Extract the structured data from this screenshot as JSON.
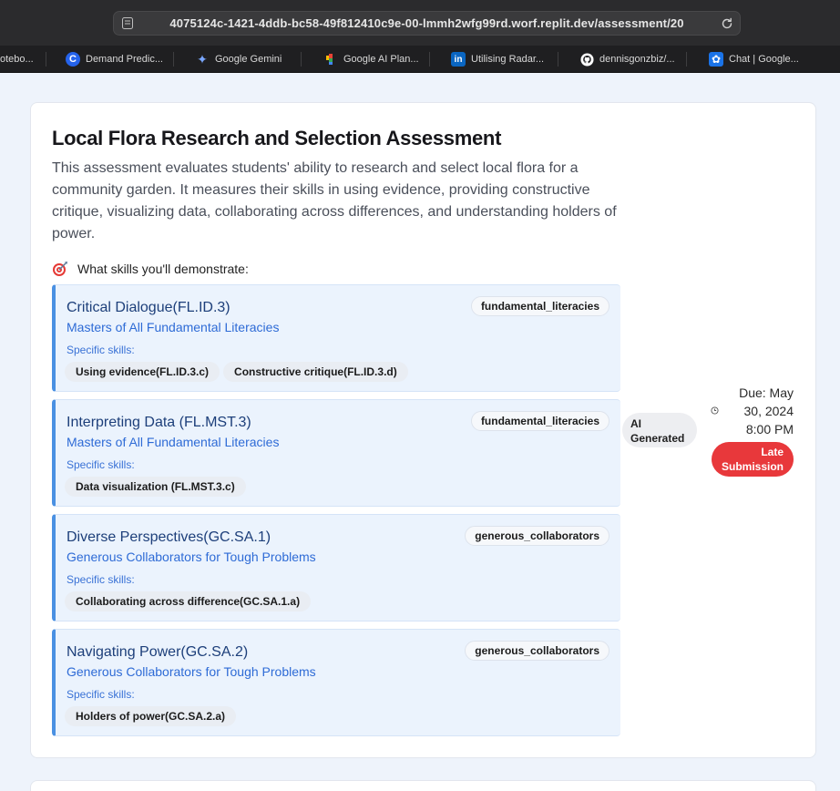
{
  "browser": {
    "url": "4075124c-1421-4ddb-bc58-49f812410c9e-00-lmmh2wfg99rd.worf.replit.dev/assessment/20",
    "bookmarks": [
      {
        "label": "otebo...",
        "icon": "notebook-icon"
      },
      {
        "label": "Demand Predic...",
        "icon": "c-logo-icon"
      },
      {
        "label": "Google Gemini",
        "icon": "gemini-icon"
      },
      {
        "label": "Google AI Plan...",
        "icon": "google-ai-icon"
      },
      {
        "label": "Utilising Radar...",
        "icon": "linkedin-icon"
      },
      {
        "label": "dennisgonzbiz/...",
        "icon": "github-icon"
      },
      {
        "label": "Chat | Google...",
        "icon": "chat-icon"
      }
    ]
  },
  "assessment": {
    "title": "Local Flora Research and Selection Assessment",
    "description": "This assessment evaluates students' ability to research and select local flora for a community garden. It measures their skills in using evidence, providing constructive critique, visualizing data, collaborating across differences, and understanding holders of power.",
    "skills_heading": "What skills you'll demonstrate:",
    "specific_label": "Specific skills:",
    "skills": [
      {
        "name": "Critical Dialogue(FL.ID.3)",
        "subtitle": "Masters of All Fundamental Literacies",
        "tag": "fundamental_literacies",
        "specific": [
          "Using evidence(FL.ID.3.c)",
          "Constructive critique(FL.ID.3.d)"
        ]
      },
      {
        "name": "Interpreting Data (FL.MST.3)",
        "subtitle": "Masters of All Fundamental Literacies",
        "tag": "fundamental_literacies",
        "specific": [
          "Data visualization (FL.MST.3.c)"
        ]
      },
      {
        "name": "Diverse Perspectives(GC.SA.1)",
        "subtitle": "Generous Collaborators for Tough Problems",
        "tag": "generous_collaborators",
        "specific": [
          "Collaborating across difference(GC.SA.1.a)"
        ]
      },
      {
        "name": "Navigating Power(GC.SA.2)",
        "subtitle": "Generous Collaborators for Tough Problems",
        "tag": "generous_collaborators",
        "specific": [
          "Holders of power(GC.SA.2.a)"
        ]
      }
    ],
    "ai_badge": "AI Generated",
    "due": "Due: May 30, 2024 8:00 PM",
    "status": "Late Submission"
  },
  "colors": {
    "accent": "#4a90e2",
    "late": "#e8383b",
    "page_bg": "#eef3fb"
  }
}
